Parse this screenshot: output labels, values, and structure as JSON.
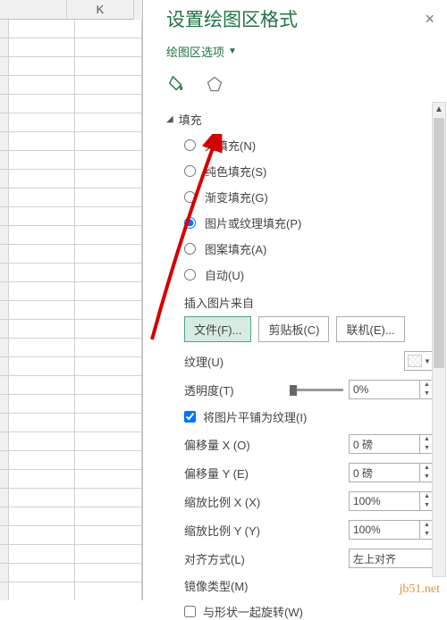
{
  "spreadsheet": {
    "col_header": "K"
  },
  "pane": {
    "title": "设置绘图区格式",
    "close": "×",
    "dropdown": "绘图区选项"
  },
  "section": {
    "fill_header": "填充",
    "radios": {
      "none": "无填充(N)",
      "solid": "纯色填充(S)",
      "gradient": "渐变填充(G)",
      "picture": "图片或纹理填充(P)",
      "pattern": "图案填充(A)",
      "auto": "自动(U)"
    },
    "insert_from": "插入图片来自",
    "buttons": {
      "file": "文件(F)...",
      "clipboard": "剪贴板(C)",
      "online": "联机(E)..."
    },
    "texture_label": "纹理(U)",
    "transparency_label": "透明度(T)",
    "transparency_value": "0%",
    "tile_label": "将图片平铺为纹理(I)",
    "offset_x_label": "偏移量 X (O)",
    "offset_x_value": "0 磅",
    "offset_y_label": "偏移量 Y (E)",
    "offset_y_value": "0 磅",
    "scale_x_label": "缩放比例 X (X)",
    "scale_x_value": "100%",
    "scale_y_label": "缩放比例 Y (Y)",
    "scale_y_value": "100%",
    "align_label": "对齐方式(L)",
    "align_value": "左上对齐",
    "mirror_label": "镜像类型(M)",
    "rotate_label": "与形状一起旋转(W)"
  },
  "watermark": "jb51.net"
}
